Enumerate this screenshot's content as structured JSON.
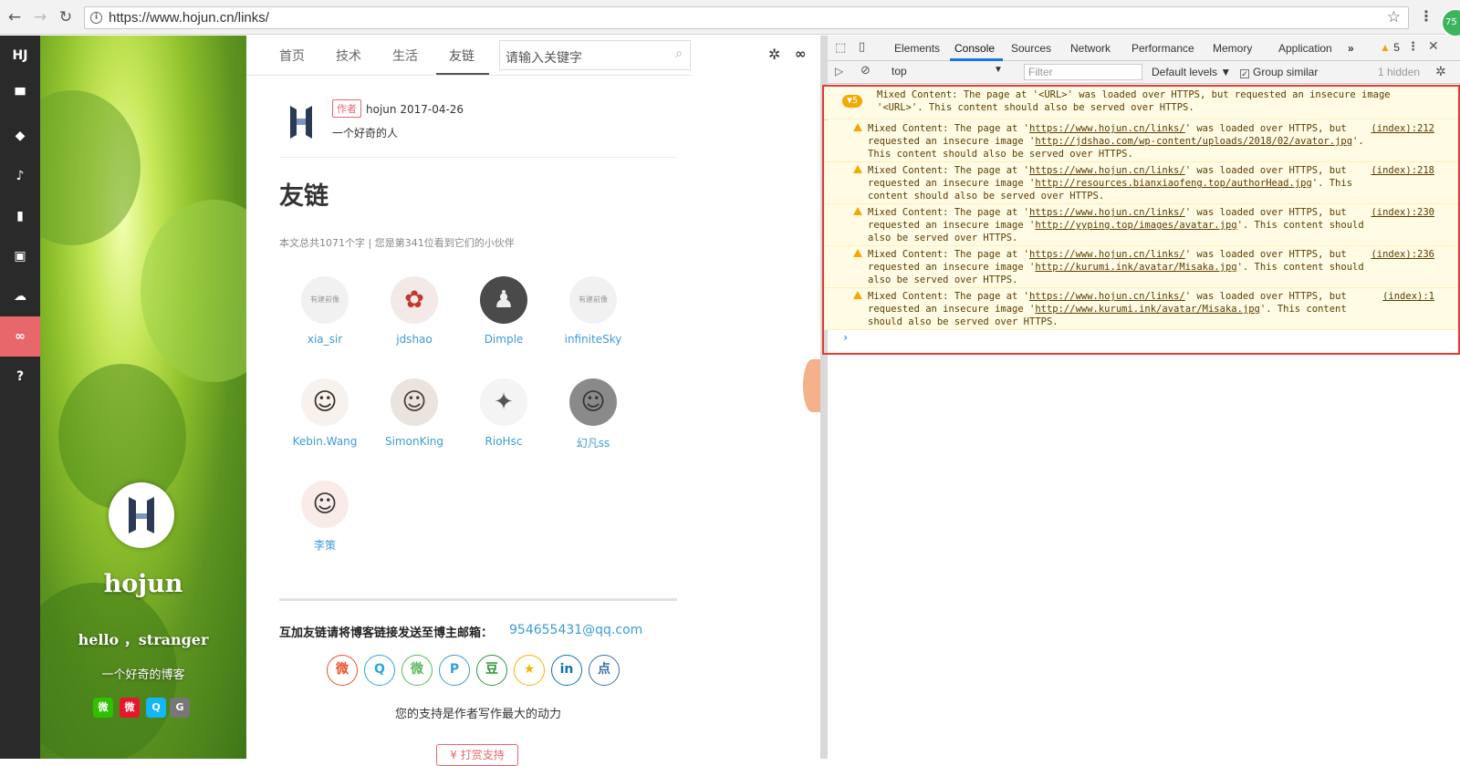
{
  "browser": {
    "url": "https://www.hojun.cn/links/",
    "back_icon": "←",
    "forward_icon": "→",
    "reload_icon": "↻",
    "star_icon": "☆",
    "menu_icon": "⋮",
    "profile_text": "75"
  },
  "iconbar": {
    "logo": "HJ",
    "items": [
      {
        "name": "archive-icon",
        "glyph": "▀"
      },
      {
        "name": "tag-icon",
        "glyph": "◆"
      },
      {
        "name": "music-icon",
        "glyph": "♪"
      },
      {
        "name": "book-icon",
        "glyph": "▮"
      },
      {
        "name": "image-icon",
        "glyph": "▣"
      },
      {
        "name": "cloud-icon",
        "glyph": "☁"
      },
      {
        "name": "link-icon",
        "glyph": "∞"
      },
      {
        "name": "help-icon",
        "glyph": "?"
      }
    ],
    "active_color": "#e8676b"
  },
  "hero": {
    "name": "hojun",
    "greeting": "hello ，stranger",
    "description": "一个好奇的博客",
    "socials": [
      {
        "name": "wechat",
        "color": "#2dc100",
        "glyph": "●"
      },
      {
        "name": "weibo",
        "color": "#e6162d",
        "glyph": "●"
      },
      {
        "name": "qq",
        "color": "#12b7f5",
        "glyph": "●"
      },
      {
        "name": "github",
        "color": "#777777",
        "glyph": "●"
      }
    ]
  },
  "topnav": {
    "tabs": [
      "首页",
      "技术",
      "生活",
      "友链"
    ],
    "active_tab": "友链",
    "search_placeholder": "请输入关键字",
    "search_icon": "⌕"
  },
  "post": {
    "badge": "作者",
    "author": "hojun",
    "date": "2017-04-26",
    "author_desc": "一个好奇的人",
    "title": "友链",
    "stats": "本文总共1071个字 | 您是第341位看到它们的小伙伴"
  },
  "friends": [
    {
      "name": "xia_sir",
      "bg": "#f1f1f1",
      "fg": "#999999",
      "mark": "有建前像"
    },
    {
      "name": "jdshao",
      "bg": "#f3e9e6",
      "fg": "#c0392b",
      "mark": "✿"
    },
    {
      "name": "Dimple",
      "bg": "#4a4a4a",
      "fg": "#eeeeee",
      "mark": "♟"
    },
    {
      "name": "infiniteSky",
      "bg": "#f1f1f1",
      "fg": "#999999",
      "mark": "有建前像"
    },
    {
      "name": "Kebin.Wang",
      "bg": "#f7f2ee",
      "fg": "#3a2a20",
      "mark": "☺"
    },
    {
      "name": "SimonKing",
      "bg": "#eae4de",
      "fg": "#4a3a30",
      "mark": "☺"
    },
    {
      "name": "RioHsc",
      "bg": "#f4f4f4",
      "fg": "#555555",
      "mark": "✦"
    },
    {
      "name": "幻凡ss",
      "bg": "#8a8a8a",
      "fg": "#333333",
      "mark": "☺"
    },
    {
      "name": "李策",
      "bg": "#f9ece8",
      "fg": "#333333",
      "mark": "☺"
    }
  ],
  "footer": {
    "exchange_text": "互加友链请将博客链接发送至博主邮箱：",
    "email": "954655431@qq.com",
    "share_icons": [
      {
        "name": "weibo",
        "color": "#e6522c",
        "glyph": "微"
      },
      {
        "name": "qq",
        "color": "#2ba6e1",
        "glyph": "Q"
      },
      {
        "name": "wechat",
        "color": "#5bb75b",
        "glyph": "微"
      },
      {
        "name": "pinterest",
        "color": "#3c9bd8",
        "glyph": "P"
      },
      {
        "name": "douban",
        "color": "#2e963d",
        "glyph": "豆"
      },
      {
        "name": "qzone",
        "color": "#f5b400",
        "glyph": "★"
      },
      {
        "name": "linkedin",
        "color": "#0e76a8",
        "glyph": "in"
      },
      {
        "name": "diandian",
        "color": "#3b6fa7",
        "glyph": "点"
      }
    ],
    "support_text": "您的支持是作者写作最大的动力",
    "reward_text": "¥ 打赏支持"
  },
  "devtools": {
    "tabs": [
      "Elements",
      "Console",
      "Sources",
      "Network",
      "Performance",
      "Memory",
      "Application"
    ],
    "active_tab": "Console",
    "more_icon": "»",
    "warning_count": "5",
    "context": "top",
    "filter_placeholder": "Filter",
    "levels": "Default levels ▼",
    "group_similar": "Group similar",
    "hidden": "1 hidden",
    "group_count": "5",
    "group_text": "Mixed Content: The page at '<URL>' was loaded over HTTPS, but requested an insecure image '<URL>'. This content should also be served over HTTPS.",
    "messages": [
      {
        "page": "https://www.hojun.cn/links/",
        "image": "http://jdshao.com/wp-content/uploads/2018/02/avator.jpg",
        "source": "(index):212"
      },
      {
        "page": "https://www.hojun.cn/links/",
        "image": "http://resources.bianxiaofeng.top/authorHead.jpg",
        "source": "(index):218"
      },
      {
        "page": "https://www.hojun.cn/links/",
        "image": "http://yyping.top/images/avatar.jpg",
        "source": "(index):230"
      },
      {
        "page": "https://www.hojun.cn/links/",
        "image": "http://kurumi.ink/avatar/Misaka.jpg",
        "source": "(index):236"
      },
      {
        "page": "https://www.hojun.cn/links/",
        "image": "http://www.kurumi.ink/avatar/Misaka.jpg",
        "source": "(index):1"
      }
    ],
    "msg_prefix": "Mixed Content: The page at '",
    "msg_mid1": "' was loaded over HTTPS, but requested an insecure image '",
    "msg_mid2": "'. This content should also be served over HTTPS.",
    "prompt": "›",
    "highlight_color": "#e53935"
  }
}
